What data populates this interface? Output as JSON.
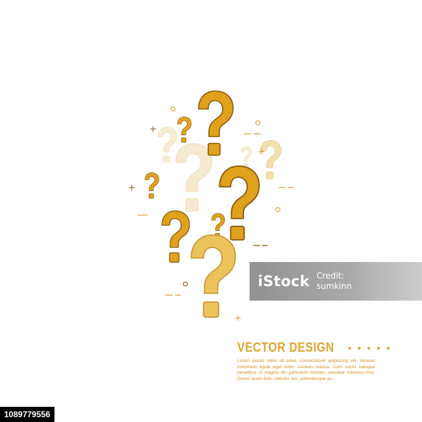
{
  "title": "VECTOR DESIGN",
  "body_text": "Lorem ipsum dolor sit amet, consectetuer adipiscing elit. Aenean commodo ligula eget dolor. Aenean massa. Cum sociis natoque penatibus et magnis dis parturient montes, nascetur ridiculus mus. Donec quam felis, ultricies nec, pellentesque eu.",
  "watermark": {
    "logo": "iStock",
    "credit_line_1": "Credit:",
    "credit_line_2": "sumkinn"
  },
  "stock_id": "1089779556",
  "colors": {
    "dark_gold": "#e0a21c",
    "dark_outline": "#8a5a0e",
    "mid_gold": "#ecc35a",
    "mid_outline": "#c79a3a",
    "pale_gold": "#f7e8c4",
    "text_gold": "#dfa62f"
  },
  "icons": [
    "question-mark-icon",
    "plus-sign-icon",
    "circle-outline-icon",
    "dash-line-icon"
  ]
}
